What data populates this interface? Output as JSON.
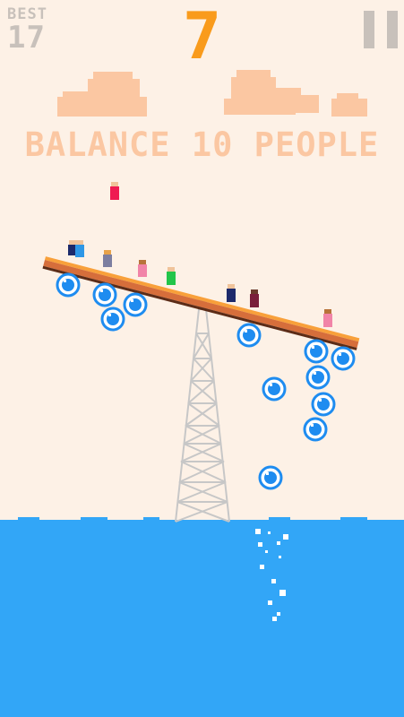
{
  "hud": {
    "best_label": "BEST",
    "best_value": "17",
    "score": "7",
    "pause_icon": "pause-icon"
  },
  "goal": {
    "text": "BALANCE 10 PEOPLE"
  },
  "colors": {
    "background": "#fdf1e6",
    "score": "#f99b1c",
    "hud_gray": "#c8c1bb",
    "goal_text": "#fbc7a2",
    "cloud": "#fbc7a2",
    "sea": "#32a6f7",
    "plank": "#d66e3b",
    "plank_edge": "#5c2c17",
    "bubble": "#1e8cf0"
  }
}
